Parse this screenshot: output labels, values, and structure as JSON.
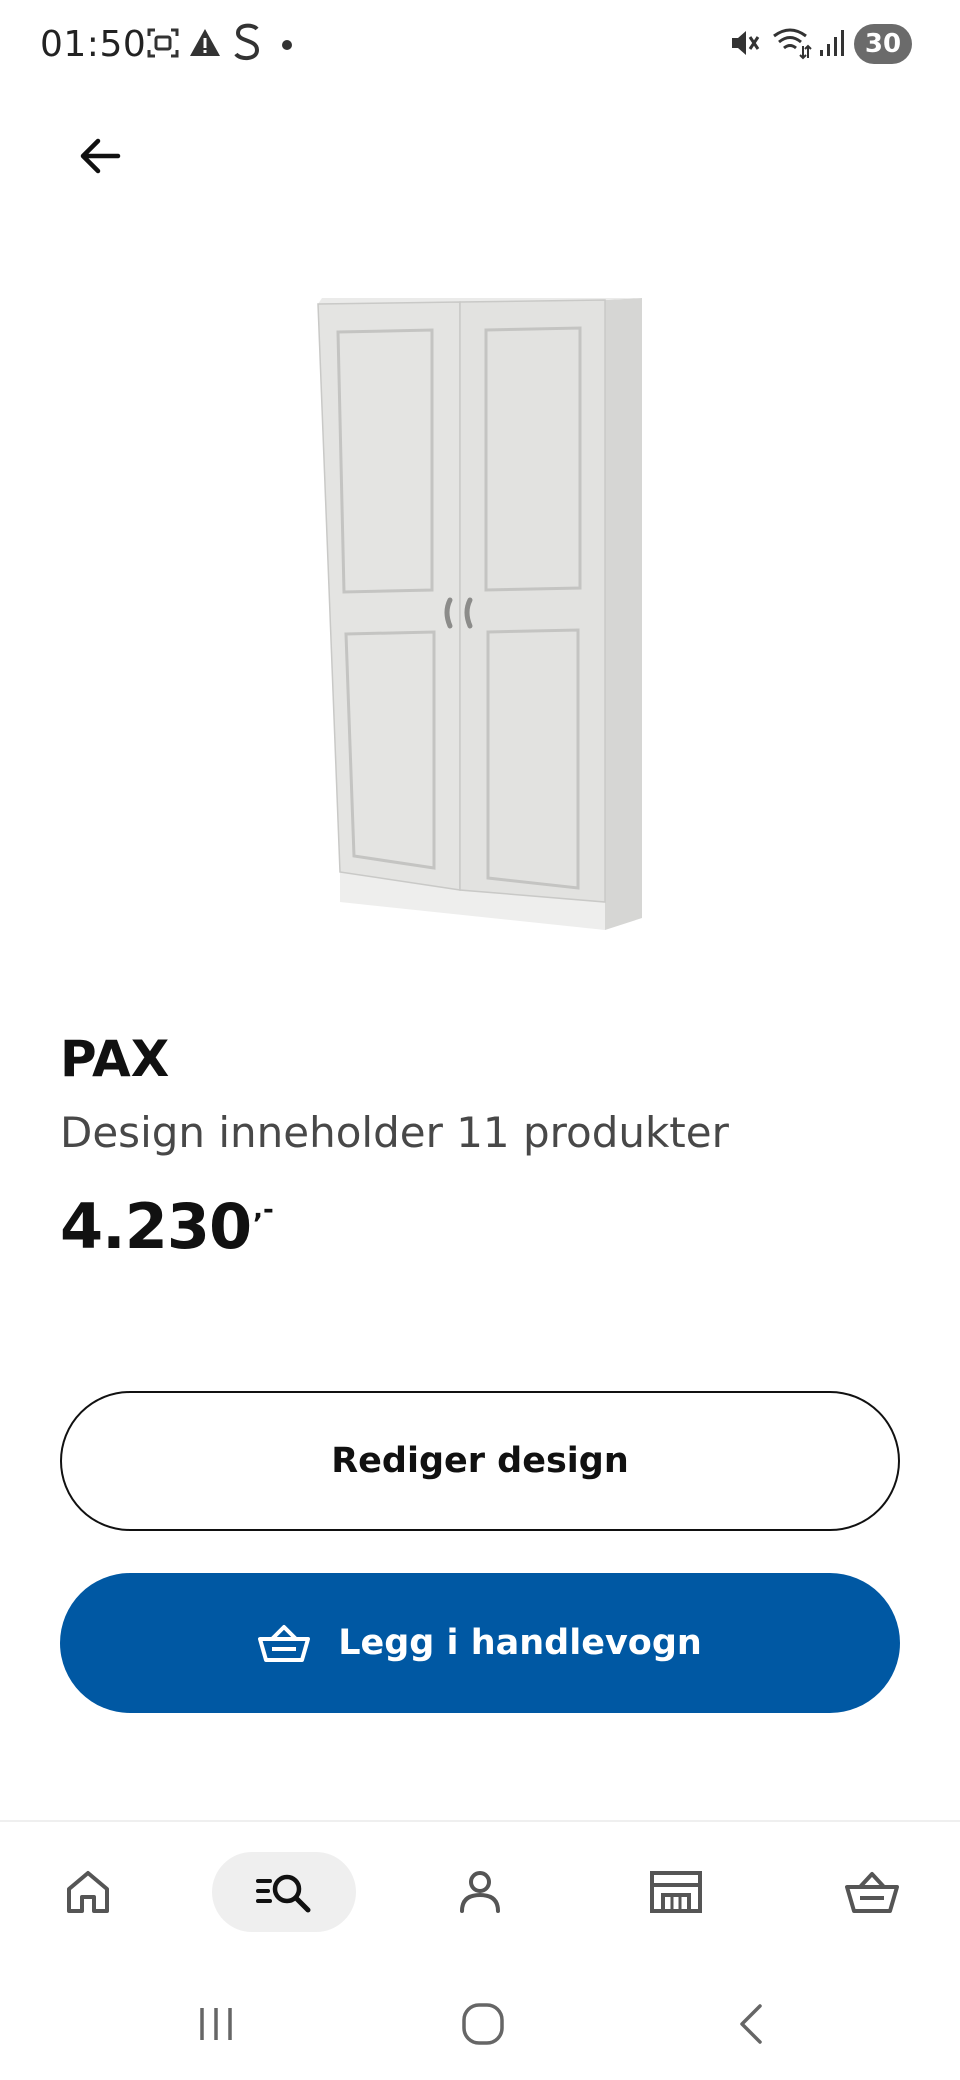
{
  "status_bar": {
    "time": "01:50",
    "battery": "30",
    "icons": [
      "screenshot-icon",
      "warning-icon",
      "s-app-icon",
      "notification-dot",
      "mute-icon",
      "wifi-icon",
      "signal-icon",
      "battery-icon"
    ]
  },
  "header": {
    "back_icon": "arrow-left-icon"
  },
  "product": {
    "name": "PAX",
    "description": "Design inneholder 11 produkter",
    "price": "4.230",
    "price_suffix": ",-"
  },
  "actions": {
    "edit_label": "Rediger design",
    "add_to_cart_label": "Legg i handlevogn",
    "add_to_cart_icon": "basket-icon"
  },
  "bottom_nav": {
    "items": [
      {
        "name": "home",
        "icon": "home-icon"
      },
      {
        "name": "search",
        "icon": "search-list-icon",
        "active": true
      },
      {
        "name": "profile",
        "icon": "person-icon"
      },
      {
        "name": "store",
        "icon": "store-icon"
      },
      {
        "name": "cart",
        "icon": "basket-icon"
      }
    ]
  },
  "colors": {
    "primary": "#0058a3",
    "text": "#111111",
    "secondary_text": "#484848",
    "nav_active_bg": "#efefef"
  }
}
